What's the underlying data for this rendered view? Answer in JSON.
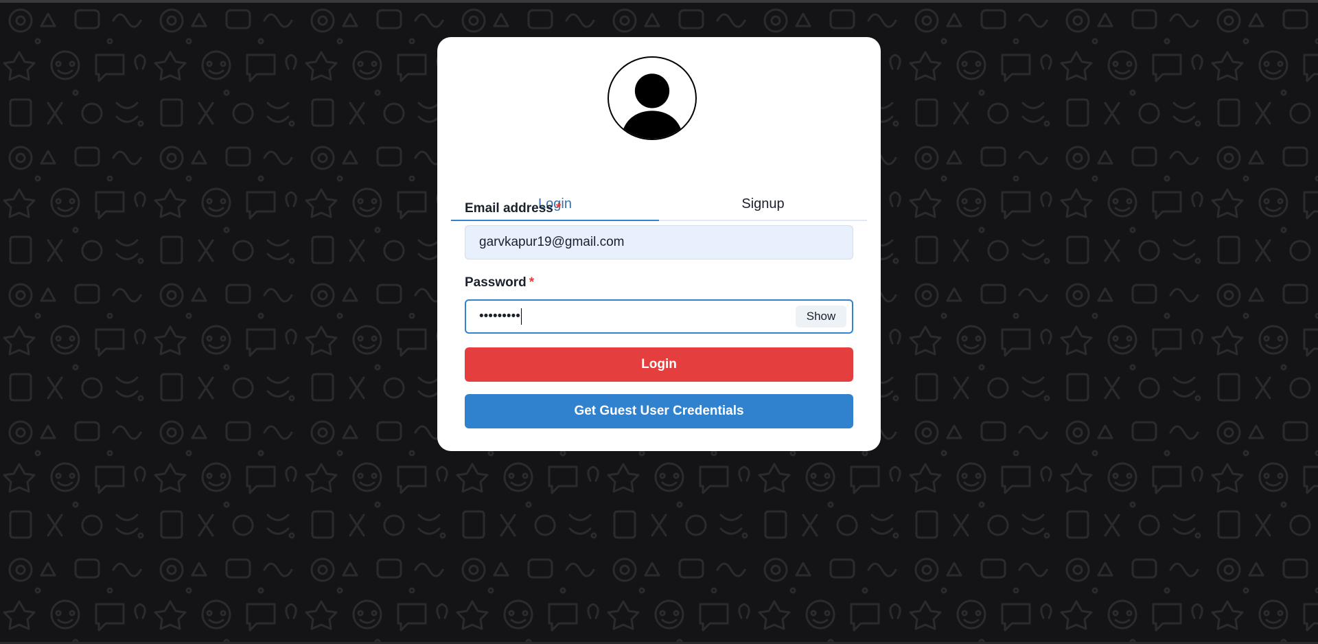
{
  "tabs": {
    "login": "Login",
    "signup": "Signup"
  },
  "form": {
    "email_label": "Email address",
    "email_required": "*",
    "email_value": "garvkapur19@gmail.com",
    "password_label": "Password",
    "password_required": "*",
    "password_value": "•••••••••",
    "show_label": "Show"
  },
  "buttons": {
    "login": "Login",
    "guest": "Get Guest User Credentials"
  },
  "colors": {
    "login_button": "#e53e3e",
    "guest_button": "#3182ce",
    "active_tab": "#3182ce",
    "background": "#141416"
  },
  "icons": {
    "avatar": "user-avatar-icon"
  }
}
